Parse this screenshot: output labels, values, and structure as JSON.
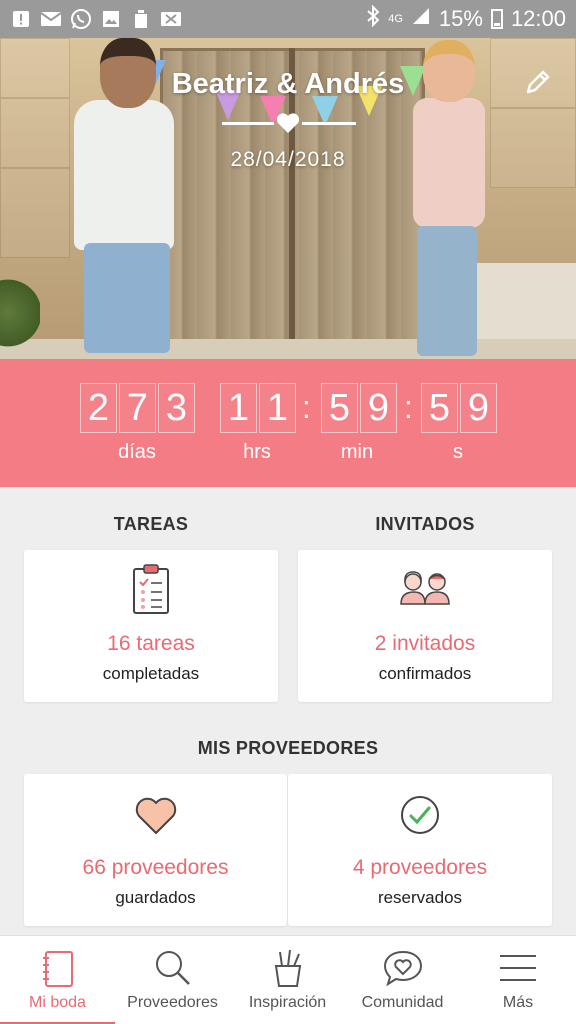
{
  "statusbar": {
    "icons": [
      "alert-icon",
      "mail-icon",
      "whatsapp-icon",
      "image-icon",
      "recycle-icon",
      "close-mail-icon"
    ],
    "right_icons": [
      "bluetooth-icon",
      "signal-icon",
      "battery-icon"
    ],
    "network": "4G",
    "battery": "15%",
    "time": "12:00"
  },
  "hero": {
    "title": "Beatriz & Andrés",
    "date": "28/04/2018"
  },
  "countdown": {
    "days": [
      "2",
      "7",
      "3"
    ],
    "hours": [
      "1",
      "1"
    ],
    "minutes": [
      "5",
      "9"
    ],
    "seconds": [
      "5",
      "9"
    ],
    "labels": {
      "days": "días",
      "hours": "hrs",
      "minutes": "min",
      "seconds": "s"
    }
  },
  "tasks": {
    "title": "TAREAS",
    "value": "16 tareas",
    "sub": "completadas"
  },
  "guests": {
    "title": "INVITADOS",
    "value": "2 invitados",
    "sub": "confirmados"
  },
  "vendors": {
    "title": "MIS PROVEEDORES",
    "saved_value": "66 proveedores",
    "saved_sub": "guardados",
    "booked_value": "4 proveedores",
    "booked_sub": "reservados"
  },
  "nav": {
    "items": [
      {
        "label": "Mi boda",
        "icon": "notebook-icon"
      },
      {
        "label": "Proveedores",
        "icon": "search-icon"
      },
      {
        "label": "Inspiración",
        "icon": "brushes-icon"
      },
      {
        "label": "Comunidad",
        "icon": "chat-heart-icon"
      },
      {
        "label": "Más",
        "icon": "menu-icon"
      }
    ],
    "active": "Mi boda"
  },
  "colors": {
    "accent": "#f47c85",
    "accent_text": "#e86a73",
    "statusbar": "#9a9a9a"
  }
}
